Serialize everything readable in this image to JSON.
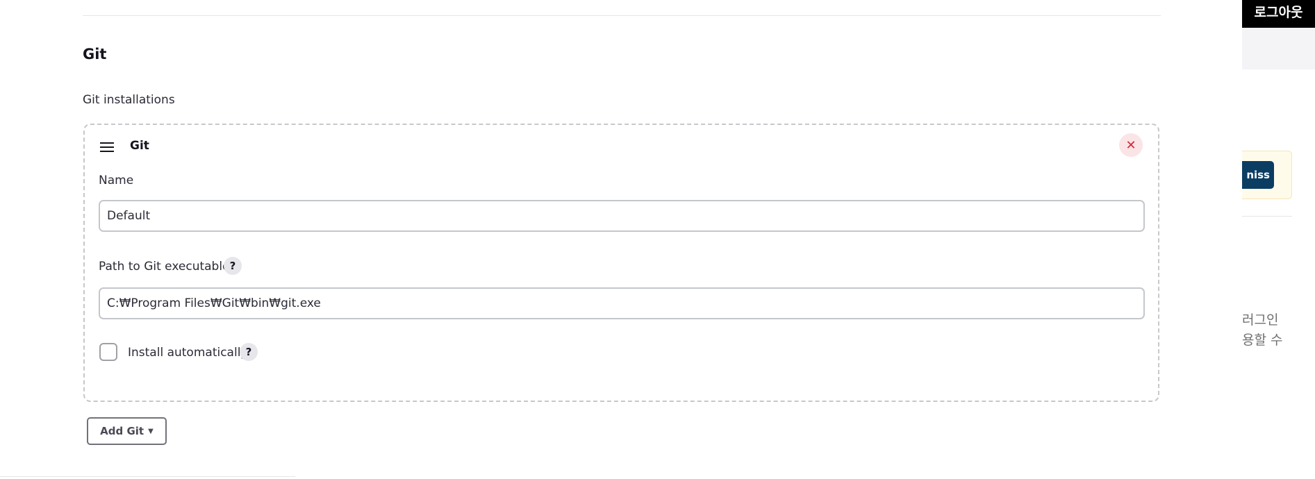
{
  "section": {
    "title": "Git",
    "subtitle": "Git installations"
  },
  "installation": {
    "title": "Git",
    "delete_glyph": "✕",
    "name_label": "Name",
    "name_value": "Default",
    "path_label": "Path to Git executable",
    "path_value": "C:₩Program Files₩Git₩bin₩git.exe",
    "help_glyph": "?",
    "install_auto_label": "Install automatically",
    "install_auto_checked": false
  },
  "add_button": {
    "label": "Add Git",
    "caret": "▼"
  },
  "overlay": {
    "logout_label": "로그아웃",
    "dismiss_label": "niss",
    "plugin_line1": "러그인",
    "plugin_line2": "용할 수"
  },
  "colors": {
    "danger": "#d0283b",
    "primary": "#0b3d63"
  },
  "icons": {
    "drag": "hamburger-icon",
    "delete": "close-icon",
    "help": "question-icon",
    "caret": "caret-down-icon"
  }
}
